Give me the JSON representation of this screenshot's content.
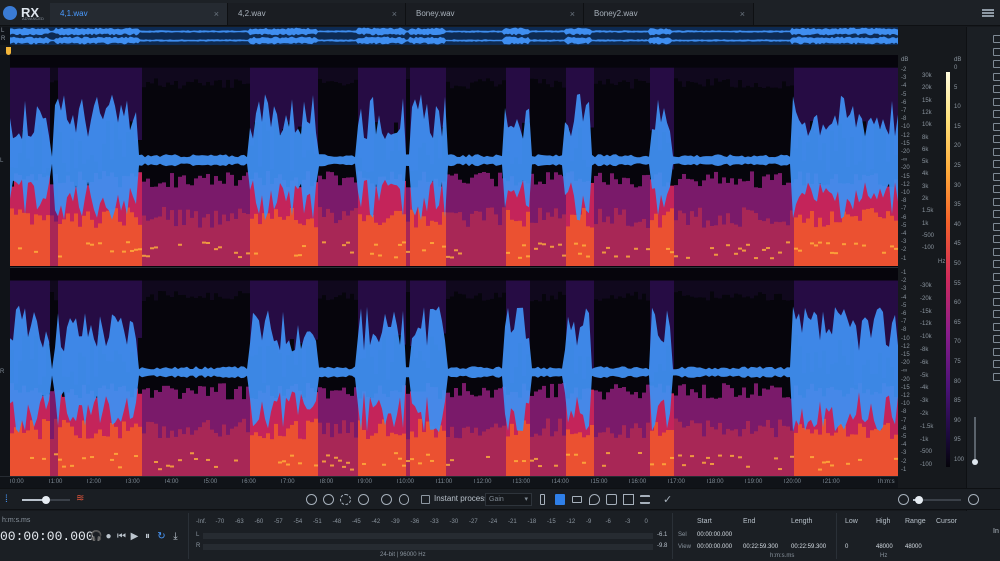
{
  "app": {
    "logo_text": "RX",
    "logo_sub": "ADVANCED"
  },
  "tabs": [
    {
      "label": "4,1.wav",
      "active": true
    },
    {
      "label": "4,2.wav",
      "active": false
    },
    {
      "label": "Boney.wav",
      "active": false
    },
    {
      "label": "Boney2.wav",
      "active": false
    }
  ],
  "tab_close": "×",
  "channels": {
    "left": "L",
    "right": "R"
  },
  "db_scale": {
    "unit": "dB",
    "top": [
      "-2",
      "-3",
      "-4",
      "-5",
      "-6",
      "-7",
      "-8",
      "-10",
      "-12",
      "-15",
      "-20",
      "-∞",
      "-20",
      "-15",
      "-12",
      "-10",
      "-8",
      "-7",
      "-6",
      "-5",
      "-4",
      "-3",
      "-2",
      "-1"
    ],
    "bottom": [
      "-1",
      "-2",
      "-3",
      "-4",
      "-5",
      "-6",
      "-7",
      "-8",
      "-10",
      "-12",
      "-15",
      "-20",
      "-∞",
      "-20",
      "-15",
      "-12",
      "-10",
      "-8",
      "-7",
      "-6",
      "-5",
      "-4",
      "-3",
      "-2",
      "-1"
    ]
  },
  "hz_scale": {
    "unit": "Hz",
    "top": [
      "30k",
      "20k",
      "15k",
      "12k",
      "10k",
      "8k",
      "6k",
      "5k",
      "4k",
      "3k",
      "2k",
      "1.5k",
      "1k",
      "-500",
      "-100"
    ],
    "bottom": [
      "-30k",
      "-20k",
      "-15k",
      "-12k",
      "-10k",
      "-8k",
      "-6k",
      "-5k",
      "-4k",
      "-3k",
      "-2k",
      "-1.5k",
      "-1k",
      "-500",
      "-100"
    ]
  },
  "color_scale": {
    "unit": "dB",
    "labels": [
      "0",
      "5",
      "10",
      "15",
      "20",
      "25",
      "30",
      "35",
      "40",
      "45",
      "50",
      "55",
      "60",
      "65",
      "70",
      "75",
      "80",
      "85",
      "90",
      "95",
      "100"
    ]
  },
  "timeline": {
    "ticks": [
      "0:00",
      "1:00",
      "2:00",
      "3:00",
      "4:00",
      "5:00",
      "6:00",
      "7:00",
      "8:00",
      "9:00",
      "10:00",
      "11:00",
      "12:00",
      "13:00",
      "14:00",
      "15:00",
      "16:00",
      "17:00",
      "18:00",
      "19:00",
      "20:00",
      "21:00"
    ],
    "end_label": "h:m:s"
  },
  "toolbar": {
    "instant_process_label": "Instant process",
    "gain_value": "Gain"
  },
  "transport": {
    "time_format": "h:m:s.ms",
    "time": "00:00:00.000",
    "glyphs": [
      "🎧",
      "●",
      "⏮",
      "▶",
      "⏸",
      "↻",
      "⤓"
    ]
  },
  "meter": {
    "scale": [
      "-Inf.",
      "-70",
      "-63",
      "-60",
      "-57",
      "-54",
      "-51",
      "-48",
      "-45",
      "-42",
      "-39",
      "-36",
      "-33",
      "-30",
      "-27",
      "-24",
      "-21",
      "-18",
      "-15",
      "-12",
      "-9",
      "-6",
      "-3",
      "0"
    ],
    "channel_l": "L",
    "channel_r": "R",
    "peak_l": "-6.1",
    "peak_r": "-9.8",
    "format": "24-bit | 96000 Hz"
  },
  "selection": {
    "headers": [
      "Start",
      "End",
      "Length"
    ],
    "rows": [
      {
        "label": "Sel",
        "start": "00:00:00.000",
        "end": "",
        "length": ""
      },
      {
        "label": "View",
        "start": "00:00:00.000",
        "end": "00:22:59.300",
        "length": "00:22:59.300"
      }
    ],
    "units": "h:m:s.ms"
  },
  "frequency_range": {
    "headers": [
      "Low",
      "High",
      "Range",
      "Cursor"
    ],
    "view": {
      "low": "0",
      "high": "48000",
      "range": "48000"
    },
    "units": "Hz"
  },
  "side_label": "In",
  "colors": {
    "accent": "#4a9bff",
    "waveform": "#3f8ef0",
    "background": "#16191d"
  }
}
